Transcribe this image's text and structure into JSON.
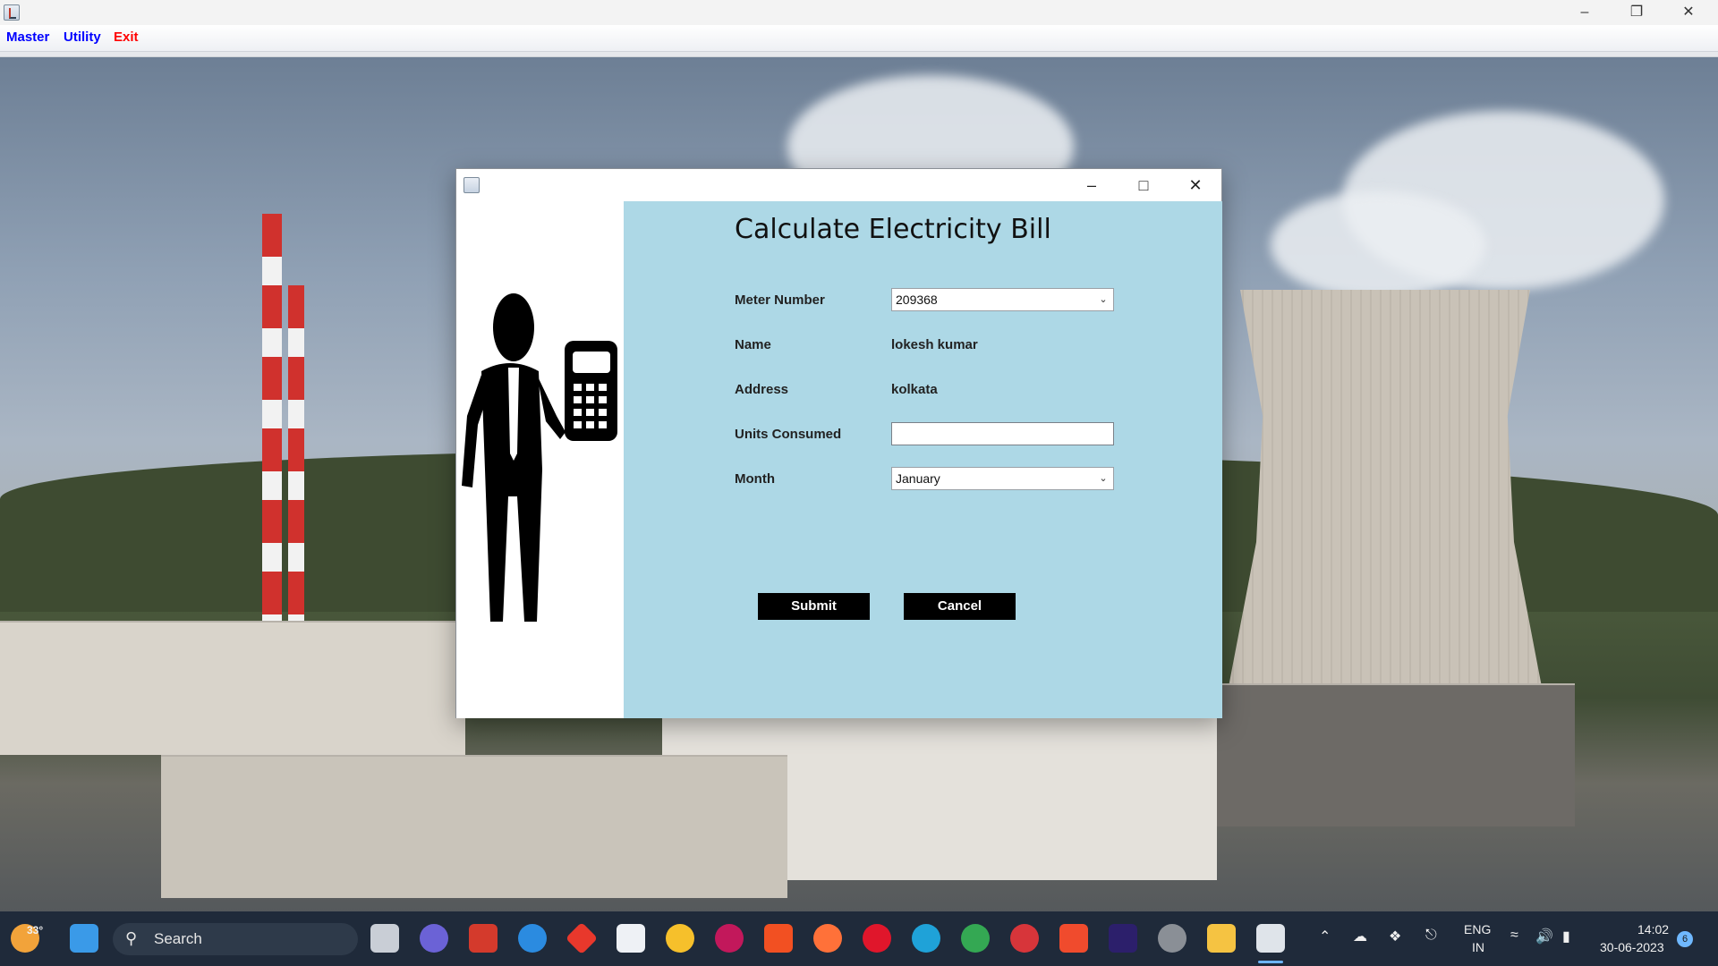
{
  "menubar": {
    "items": [
      {
        "label": "Master",
        "color": "#0000ff"
      },
      {
        "label": "Utility",
        "color": "#0000ff"
      },
      {
        "label": "Exit",
        "color": "#ff0000"
      }
    ]
  },
  "dialog": {
    "title": "Calculate Electricity Bill",
    "fields": {
      "meter_number_label": "Meter Number",
      "meter_number_value": "209368",
      "name_label": "Name",
      "name_value": "lokesh kumar",
      "address_label": "Address",
      "address_value": "kolkata",
      "units_label": "Units Consumed",
      "units_value": "",
      "month_label": "Month",
      "month_value": "January"
    },
    "buttons": {
      "submit": "Submit",
      "cancel": "Cancel"
    }
  },
  "taskbar": {
    "weather": "33°",
    "search_placeholder": "Search",
    "lang_top": "ENG",
    "lang_bottom": "IN",
    "time": "14:02",
    "date": "30-06-2023",
    "notifications": "6"
  },
  "colors": {
    "panel_bg": "#add8e6",
    "button_bg": "#000000"
  }
}
